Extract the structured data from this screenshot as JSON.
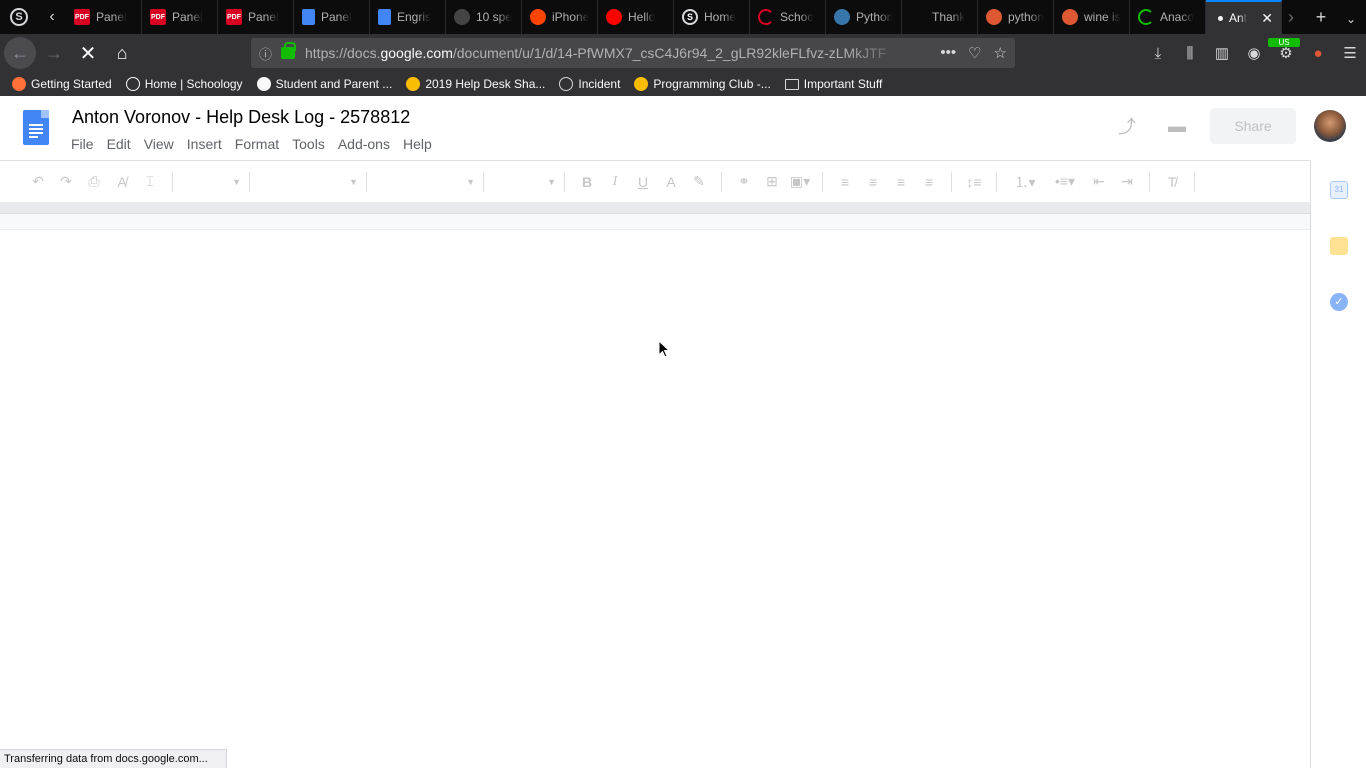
{
  "browser": {
    "tabs": [
      {
        "title": "Panel",
        "icon": "pdf-icon",
        "color": "#d70022"
      },
      {
        "title": "Panel",
        "icon": "pdf-icon",
        "color": "#d70022"
      },
      {
        "title": "Panel",
        "icon": "pdf-icon",
        "color": "#d70022"
      },
      {
        "title": "Panel",
        "icon": "docs-icon",
        "color": "#4285f4"
      },
      {
        "title": "Engris",
        "icon": "docs-icon",
        "color": "#4285f4"
      },
      {
        "title": "10 spe",
        "icon": "site-icon",
        "color": "#444444"
      },
      {
        "title": "iPhone",
        "icon": "reddit-icon",
        "color": "#ff4500"
      },
      {
        "title": "Hello",
        "icon": "youtube-icon",
        "color": "#ff0000"
      },
      {
        "title": "Home",
        "icon": "schoology-icon",
        "color": "#1a1a1a"
      },
      {
        "title": "Schoo",
        "icon": "loading-icon",
        "color": "#d70022"
      },
      {
        "title": "Python",
        "icon": "python-icon",
        "color": "#3776ab"
      },
      {
        "title": "Thank",
        "icon": "blank-icon",
        "color": "#0c0c0d"
      },
      {
        "title": "python",
        "icon": "duckduckgo-icon",
        "color": "#de5833"
      },
      {
        "title": "wine is",
        "icon": "duckduckgo-icon",
        "color": "#de5833"
      },
      {
        "title": "Anaco",
        "icon": "loading-icon",
        "color": "#12bc00"
      },
      {
        "title": "Ant",
        "icon": "dot-icon",
        "color": "#f9f9fa",
        "active": true
      }
    ],
    "url_prefix": "https://docs.",
    "url_domain": "google.com",
    "url_rest": "/document/u/1/d/14-PfWMX7_csC4J6r94_2_gLR92kleFLfvz-zLMkJTF",
    "extension_badge": "US",
    "bookmarks": [
      {
        "label": "Getting Started",
        "icon": "firefox-icon"
      },
      {
        "label": "Home | Schoology",
        "icon": "schoology-icon"
      },
      {
        "label": "Student and Parent ...",
        "icon": "flag-icon"
      },
      {
        "label": "2019 Help Desk Sha...",
        "icon": "drive-icon"
      },
      {
        "label": "Incident",
        "icon": "globe-icon"
      },
      {
        "label": "Programming Club -...",
        "icon": "drive-icon"
      },
      {
        "label": "Important Stuff",
        "icon": "folder-icon"
      }
    ],
    "status_text": "Transferring data from docs.google.com..."
  },
  "doc": {
    "title": "Anton Voronov - Help Desk Log - 2578812",
    "menus": [
      "File",
      "Edit",
      "View",
      "Insert",
      "Format",
      "Tools",
      "Add-ons",
      "Help"
    ],
    "share_label": "Share",
    "calendar_day": "31"
  }
}
